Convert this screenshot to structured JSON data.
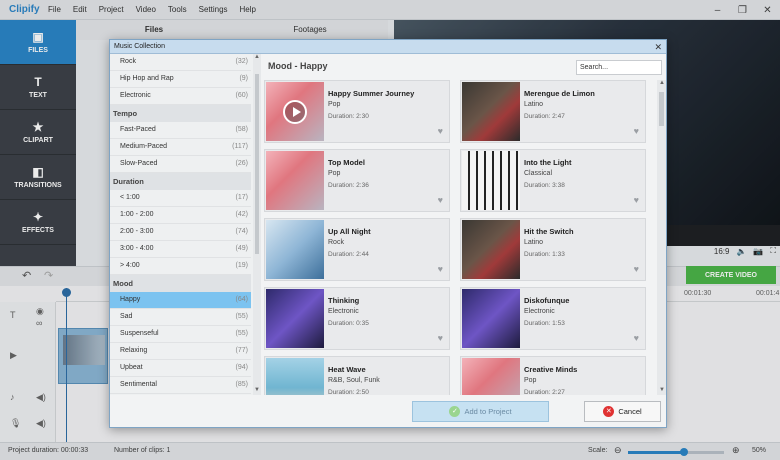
{
  "app": {
    "name": "Clipify",
    "menu": [
      "File",
      "Edit",
      "Project",
      "Video",
      "Tools",
      "Settings",
      "Help"
    ],
    "window_buttons": [
      "–",
      "❐",
      "✕"
    ]
  },
  "nav": [
    {
      "label": "FILES",
      "icon": "film-icon",
      "glyph": "▣"
    },
    {
      "label": "TEXT",
      "icon": "text-icon",
      "glyph": "T"
    },
    {
      "label": "CLIPART",
      "icon": "star-icon",
      "glyph": "★"
    },
    {
      "label": "TRANSITIONS",
      "icon": "transitions-icon",
      "glyph": "◧"
    },
    {
      "label": "EFFECTS",
      "icon": "magic-wand-icon",
      "glyph": "✦"
    }
  ],
  "tabs": {
    "files": "Files",
    "footages": "Footages"
  },
  "preview": {
    "aspect": "16:9",
    "create_video": "CREATE VIDEO"
  },
  "timeline": {
    "ticks": [
      "00:01:30",
      "00:01:4"
    ]
  },
  "status": {
    "project_duration": "Project duration: 00:00:33",
    "clips": "Number of clips: 1",
    "scale_label": "Scale:",
    "scale_value": "50%",
    "scale_fraction": 0.58
  },
  "dialog": {
    "title": "Music Collection",
    "close": "✕",
    "mood_title": "Mood - Happy",
    "search_value": "Search...",
    "add_button": "Add to Project",
    "cancel_button": "Cancel",
    "categories": [
      {
        "type": "item",
        "label": "Rock",
        "count": "(32)"
      },
      {
        "type": "item",
        "label": "Hip Hop and Rap",
        "count": "(9)"
      },
      {
        "type": "item",
        "label": "Electronic",
        "count": "(60)"
      },
      {
        "type": "head",
        "label": "Tempo"
      },
      {
        "type": "item",
        "label": "Fast-Paced",
        "count": "(58)"
      },
      {
        "type": "item",
        "label": "Medium-Paced",
        "count": "(117)"
      },
      {
        "type": "item",
        "label": "Slow-Paced",
        "count": "(26)"
      },
      {
        "type": "head",
        "label": "Duration"
      },
      {
        "type": "item",
        "label": "< 1:00",
        "count": "(17)"
      },
      {
        "type": "item",
        "label": "1:00 - 2:00",
        "count": "(42)"
      },
      {
        "type": "item",
        "label": "2:00 - 3:00",
        "count": "(74)"
      },
      {
        "type": "item",
        "label": "3:00 - 4:00",
        "count": "(49)"
      },
      {
        "type": "item",
        "label": "> 4:00",
        "count": "(19)"
      },
      {
        "type": "head",
        "label": "Mood"
      },
      {
        "type": "item",
        "label": "Happy",
        "count": "(64)",
        "selected": true
      },
      {
        "type": "item",
        "label": "Sad",
        "count": "(55)"
      },
      {
        "type": "item",
        "label": "Suspenseful",
        "count": "(55)"
      },
      {
        "type": "item",
        "label": "Relaxing",
        "count": "(77)"
      },
      {
        "type": "item",
        "label": "Upbeat",
        "count": "(94)"
      },
      {
        "type": "item",
        "label": "Sentimental",
        "count": "(85)"
      }
    ],
    "tracks": [
      {
        "title": "Happy Summer Journey",
        "genre": "Pop",
        "duration": "Duration: 2:30",
        "thumb": "t-pink",
        "playing": true
      },
      {
        "title": "Merengue de Limon",
        "genre": "Latino",
        "duration": "Duration: 2:47",
        "thumb": "t-dark"
      },
      {
        "title": "Top Model",
        "genre": "Pop",
        "duration": "Duration: 2:36",
        "thumb": "t-pink"
      },
      {
        "title": "Into the Light",
        "genre": "Classical",
        "duration": "Duration: 3:38",
        "thumb": "t-piano"
      },
      {
        "title": "Up All Night",
        "genre": "Rock",
        "duration": "Duration: 2:44",
        "thumb": "t-blue"
      },
      {
        "title": "Hit the Switch",
        "genre": "Latino",
        "duration": "Duration: 1:33",
        "thumb": "t-dark"
      },
      {
        "title": "Thinking",
        "genre": "Electronic",
        "duration": "Duration: 0:35",
        "thumb": "t-purple"
      },
      {
        "title": "Diskofunque",
        "genre": "Electronic",
        "duration": "Duration: 1:53",
        "thumb": "t-purple"
      },
      {
        "title": "Heat Wave",
        "genre": "R&B, Soul, Funk",
        "duration": "Duration: 2:50",
        "thumb": "t-beach"
      },
      {
        "title": "Creative Minds",
        "genre": "Pop",
        "duration": "Duration: 2:27",
        "thumb": "t-pink"
      }
    ]
  }
}
